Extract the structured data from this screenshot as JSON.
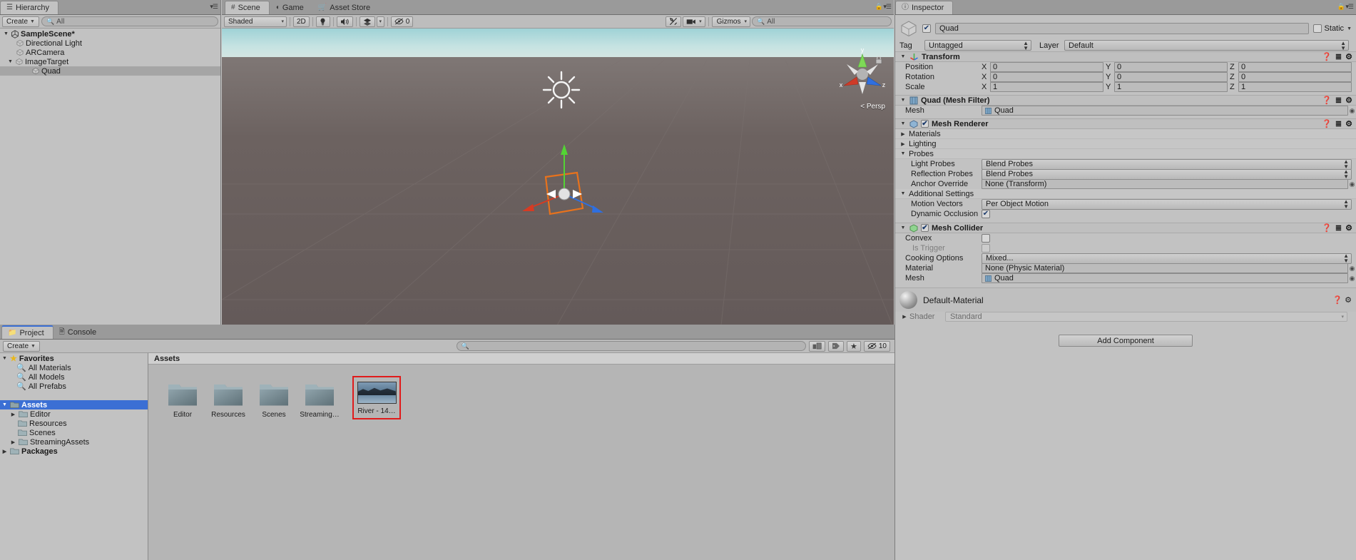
{
  "hierarchy": {
    "tab_label": "Hierarchy",
    "tab_icon": "hierarchy-icon",
    "create_label": "Create",
    "search_placeholder": "All",
    "items": [
      {
        "label": "SampleScene*",
        "depth": 0,
        "arrow": "down",
        "icon": "unity-scene-icon",
        "selected": false,
        "bold": true
      },
      {
        "label": "Directional Light",
        "depth": 2,
        "arrow": "none",
        "icon": "gameobject-cube-icon",
        "selected": false,
        "bold": false
      },
      {
        "label": "ARCamera",
        "depth": 2,
        "arrow": "none",
        "icon": "gameobject-cube-icon",
        "selected": false,
        "bold": false
      },
      {
        "label": "ImageTarget",
        "depth": 1,
        "arrow": "down",
        "icon": "gameobject-cube-icon",
        "selected": false,
        "bold": false
      },
      {
        "label": "Quad",
        "depth": 3,
        "arrow": "none",
        "icon": "gameobject-cube-icon",
        "selected": true,
        "bold": false
      }
    ]
  },
  "scene": {
    "tabs": [
      {
        "label": "Scene",
        "icon": "scene-grid-icon",
        "active": true
      },
      {
        "label": "Game",
        "icon": "game-pacman-icon",
        "active": false
      },
      {
        "label": "Asset Store",
        "icon": "asset-store-icon",
        "active": false
      }
    ],
    "toolbar": {
      "draw_mode": "Shaded",
      "two_d": "2D",
      "lighting_icon": "lightbulb-icon",
      "audio_icon": "speaker-icon",
      "fx_icon": "fx-layers-icon",
      "hidden_count": "0",
      "hidden_icon": "eye-slash-icon",
      "tools_icon": "tools-icon",
      "camera_icon": "camera-icon",
      "gizmos_label": "Gizmos",
      "search_placeholder": "All"
    },
    "viewport": {
      "persp_label": "Persp",
      "gizmo_axes": {
        "x": "x",
        "y": "y",
        "z": "z"
      }
    }
  },
  "inspector": {
    "tab_label": "Inspector",
    "tab_icon": "info-circle-icon",
    "object": {
      "enabled": true,
      "name": "Quad",
      "static_label": "Static",
      "static_checked": false,
      "tag_label": "Tag",
      "tag_value": "Untagged",
      "layer_label": "Layer",
      "layer_value": "Default"
    },
    "transform": {
      "title": "Transform",
      "rows": [
        {
          "label": "Position",
          "x": "0",
          "y": "0",
          "z": "0"
        },
        {
          "label": "Rotation",
          "x": "0",
          "y": "0",
          "z": "0"
        },
        {
          "label": "Scale",
          "x": "1",
          "y": "1",
          "z": "1"
        }
      ]
    },
    "mesh_filter": {
      "title": "Quad (Mesh Filter)",
      "mesh_label": "Mesh",
      "mesh_value": "Quad"
    },
    "mesh_renderer": {
      "title": "Mesh Renderer",
      "enabled": true,
      "sections": [
        {
          "label": "Materials",
          "open": false
        },
        {
          "label": "Lighting",
          "open": false
        },
        {
          "label": "Probes",
          "open": true
        }
      ],
      "light_probes_label": "Light Probes",
      "light_probes_value": "Blend Probes",
      "reflection_probes_label": "Reflection Probes",
      "reflection_probes_value": "Blend Probes",
      "anchor_override_label": "Anchor Override",
      "anchor_override_value": "None (Transform)",
      "additional_settings_label": "Additional Settings",
      "motion_vectors_label": "Motion Vectors",
      "motion_vectors_value": "Per Object Motion",
      "dynamic_occlusion_label": "Dynamic Occlusion",
      "dynamic_occlusion_checked": true
    },
    "mesh_collider": {
      "title": "Mesh Collider",
      "enabled": true,
      "convex_label": "Convex",
      "convex_checked": false,
      "is_trigger_label": "Is Trigger",
      "is_trigger_checked": false,
      "cooking_options_label": "Cooking Options",
      "cooking_options_value": "Mixed...",
      "material_label": "Material",
      "material_value": "None (Physic Material)",
      "mesh_label": "Mesh",
      "mesh_value": "Quad"
    },
    "material": {
      "title": "Default-Material",
      "shader_label": "Shader",
      "shader_value": "Standard"
    },
    "add_component_label": "Add Component"
  },
  "project": {
    "tabs": [
      {
        "label": "Project",
        "icon": "folder-icon",
        "active": true
      },
      {
        "label": "Console",
        "icon": "console-icon",
        "active": false
      }
    ],
    "create_label": "Create",
    "search_placeholder": "",
    "toolbar_icons": [
      "packages-icon",
      "label-icon",
      "star-icon",
      "eye-icon"
    ],
    "hidden_count": "10",
    "tree": [
      {
        "label": "Favorites",
        "depth": 0,
        "arrow": "down",
        "icon": "star-icon",
        "bold": true,
        "selected": false
      },
      {
        "label": "All Materials",
        "depth": 1,
        "arrow": "none",
        "icon": "search-icon",
        "bold": false,
        "selected": false
      },
      {
        "label": "All Models",
        "depth": 1,
        "arrow": "none",
        "icon": "search-icon",
        "bold": false,
        "selected": false
      },
      {
        "label": "All Prefabs",
        "depth": 1,
        "arrow": "none",
        "icon": "search-icon",
        "bold": false,
        "selected": false
      },
      {
        "label": "",
        "depth": 0,
        "arrow": "none",
        "icon": "none",
        "bold": false,
        "selected": false
      },
      {
        "label": "Assets",
        "depth": 0,
        "arrow": "down",
        "icon": "folder-icon",
        "bold": true,
        "selected": true
      },
      {
        "label": "Editor",
        "depth": 1,
        "arrow": "right",
        "icon": "folder-icon",
        "bold": false,
        "selected": false
      },
      {
        "label": "Resources",
        "depth": 1,
        "arrow": "none",
        "icon": "folder-icon",
        "bold": false,
        "selected": false
      },
      {
        "label": "Scenes",
        "depth": 1,
        "arrow": "none",
        "icon": "folder-icon",
        "bold": false,
        "selected": false
      },
      {
        "label": "StreamingAssets",
        "depth": 1,
        "arrow": "right",
        "icon": "folder-icon",
        "bold": false,
        "selected": false
      },
      {
        "label": "Packages",
        "depth": 0,
        "arrow": "right",
        "icon": "folder-icon",
        "bold": true,
        "selected": false
      }
    ],
    "breadcrumb": "Assets",
    "assets": [
      {
        "label": "Editor",
        "type": "folder",
        "selected": false
      },
      {
        "label": "Resources",
        "type": "folder",
        "selected": false
      },
      {
        "label": "Scenes",
        "type": "folder",
        "selected": false
      },
      {
        "label": "Streaming…",
        "type": "folder",
        "selected": false
      },
      {
        "label": "River - 14…",
        "type": "texture",
        "selected": true
      }
    ],
    "selection_color": "#e01b1b"
  }
}
